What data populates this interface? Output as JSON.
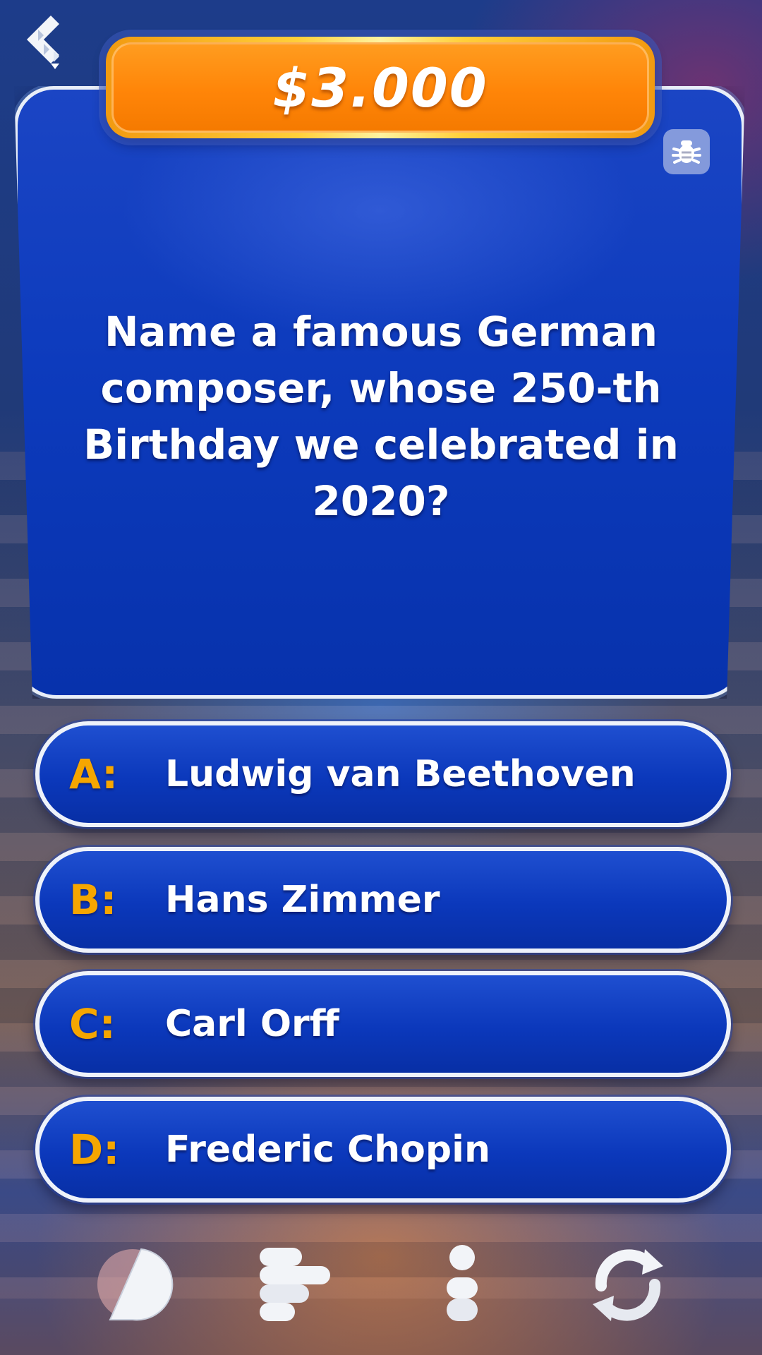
{
  "prize": {
    "amount": "$3.000"
  },
  "question": {
    "text": "Name a famous German composer, whose 250-th Birthday we celebrated in 2020?"
  },
  "answers": [
    {
      "letter": "A:",
      "text": "Ludwig van Beethoven"
    },
    {
      "letter": "B:",
      "text": "Hans Zimmer"
    },
    {
      "letter": "C:",
      "text": "Carl Orff"
    },
    {
      "letter": "D:",
      "text": "Frederic Chopin"
    }
  ],
  "icons": {
    "back": "back-chevron-icon",
    "bug": "bug-icon",
    "lifelines": [
      "fifty-fifty-icon",
      "ask-audience-icon",
      "phone-friend-icon",
      "swap-question-icon"
    ]
  },
  "colors": {
    "panel_blue": "#0d3bbd",
    "answer_letter": "#f5a600",
    "prize_orange": "#ff8508",
    "prize_gold": "#ffcf3a"
  }
}
